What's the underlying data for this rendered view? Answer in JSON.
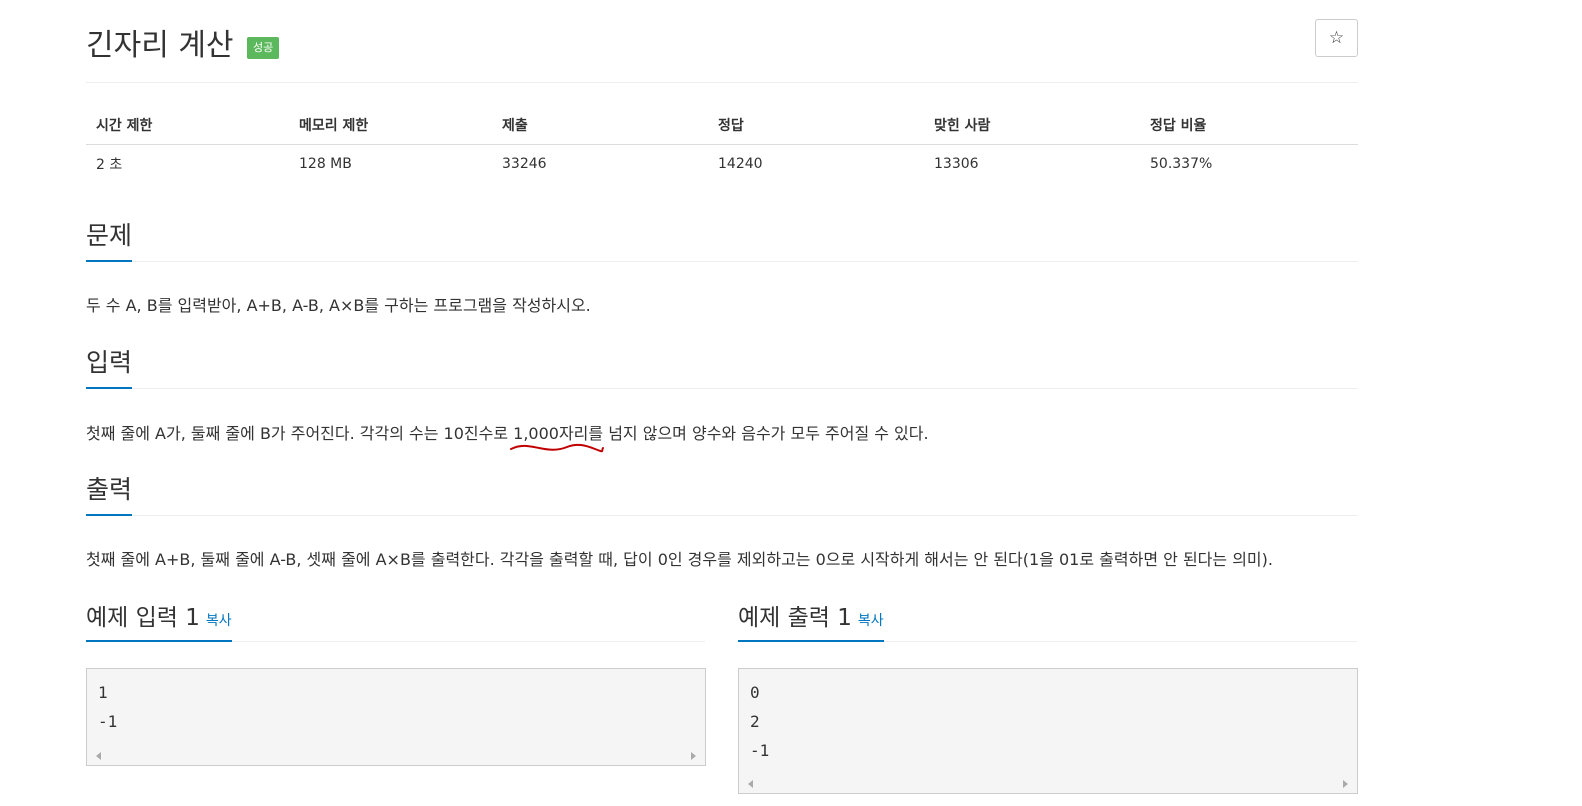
{
  "problem": {
    "title": "긴자리 계산",
    "status_badge": "성공",
    "star_icon": "☆"
  },
  "info_table": {
    "headers": [
      "시간 제한",
      "메모리 제한",
      "제출",
      "정답",
      "맞힌 사람",
      "정답 비율"
    ],
    "values": [
      "2 초",
      "128 MB",
      "33246",
      "14240",
      "13306",
      "50.337%"
    ]
  },
  "sections": {
    "problem": {
      "heading": "문제",
      "text": "두 수 A, B를 입력받아, A+B, A-B, A×B를 구하는 프로그램을 작성하시오."
    },
    "input": {
      "heading": "입력",
      "text_before": "첫째 줄에 A가, 둘째 줄에 B가 주어진다. 각각의 수는 10진수로 ",
      "text_marked": "1,000자리",
      "text_after": "를 넘지 않으며 양수와 음수가 모두 주어질 수 있다."
    },
    "output": {
      "heading": "출력",
      "text": "첫째 줄에 A+B, 둘째 줄에 A-B, 셋째 줄에 A×B를 출력한다. 각각을 출력할 때, 답이 0인 경우를 제외하고는 0으로 시작하게 해서는 안 된다(1을 01로 출력하면 안 된다는 의미)."
    }
  },
  "samples": {
    "input": {
      "heading": "예제 입력 1",
      "copy_label": "복사",
      "lines": [
        "1",
        "-1"
      ]
    },
    "output": {
      "heading": "예제 출력 1",
      "copy_label": "복사",
      "lines": [
        "0",
        "2",
        "-1"
      ]
    }
  },
  "colors": {
    "accent": "#0076c0",
    "badge": "#5cb85c",
    "annotation": "#c00000"
  }
}
